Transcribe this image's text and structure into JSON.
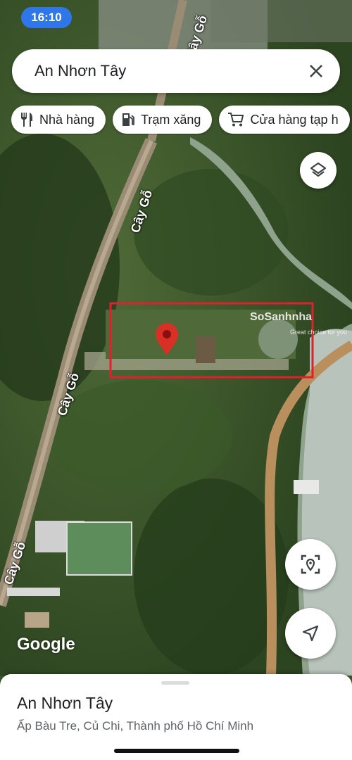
{
  "status": {
    "time": "16:10"
  },
  "search": {
    "query": "An Nhơn Tây"
  },
  "chips": [
    {
      "label": "Nhà hàng",
      "icon": "restaurant-icon"
    },
    {
      "label": "Trạm xăng",
      "icon": "gas-station-icon"
    },
    {
      "label": "Cửa hàng tạp h",
      "icon": "cart-icon"
    }
  ],
  "map": {
    "road_labels": [
      "Cây Gỗ",
      "Cây Gỗ",
      "Cây Gỗ",
      "Cây Gỗ"
    ],
    "watermark": "SoSanhnha",
    "watermark_sub": "Great choice for you",
    "attribution": "Google",
    "marker_color": "#d93025",
    "highlight_color": "#e0202a"
  },
  "place": {
    "title": "An Nhơn Tây",
    "address": "Ấp Bàu Tre, Củ Chi, Thành phố Hồ Chí Minh"
  },
  "controls": {
    "layers": "layers-icon",
    "locate": "my-location-icon",
    "directions": "navigation-arrow-icon",
    "close": "close-icon"
  }
}
